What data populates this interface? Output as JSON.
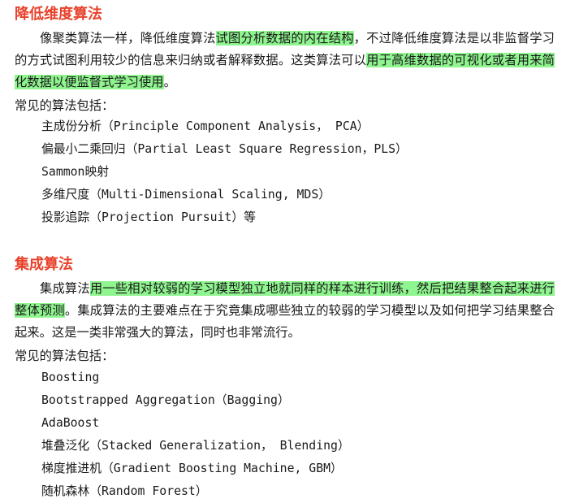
{
  "sections": [
    {
      "title": "降低维度算法",
      "paragraph": {
        "text1": "像聚类算法一样，降低维度算法",
        "highlight1": "试图分析数据的内在结构",
        "text2": "，不过降低维度算法是以非监督学习的方式试图利用较少的信息来归纳或者解释数据。这类算法可以",
        "highlight2": "用于高维数据的可视化或者用来简化数据以便监督式学习使用",
        "text3": "。"
      },
      "list_intro": "常见的算法包括：",
      "items": [
        "主成份分析（Principle Component Analysis， PCA）",
        "偏最小二乘回归（Partial Least Square Regression，PLS）",
        "Sammon映射",
        "多维尺度（Multi-Dimensional Scaling, MDS）",
        "投影追踪（Projection Pursuit）等"
      ]
    },
    {
      "title": "集成算法",
      "paragraph": {
        "text1": "集成算法",
        "highlight1": "用一些相对较弱的学习模型独立地就同样的样本进行训练，然后把结果整合起来进行整体预测",
        "text2": "。集成算法的主要难点在于究竟集成哪些独立的较弱的学习模型以及如何把学习结果整合起来。这是一类非常强大的算法，同时也非常流行。",
        "highlight2": "",
        "text3": ""
      },
      "list_intro": "常见的算法包括：",
      "items": [
        "Boosting",
        "Bootstrapped Aggregation（Bagging）",
        "AdaBoost",
        "堆叠泛化（Stacked Generalization， Blending）",
        "梯度推进机（Gradient Boosting Machine, GBM）",
        "随机森林（Random Forest）"
      ]
    }
  ],
  "colors": {
    "heading": "#e8412a",
    "highlight": "#8ff58f",
    "text": "#1a1a1a"
  }
}
